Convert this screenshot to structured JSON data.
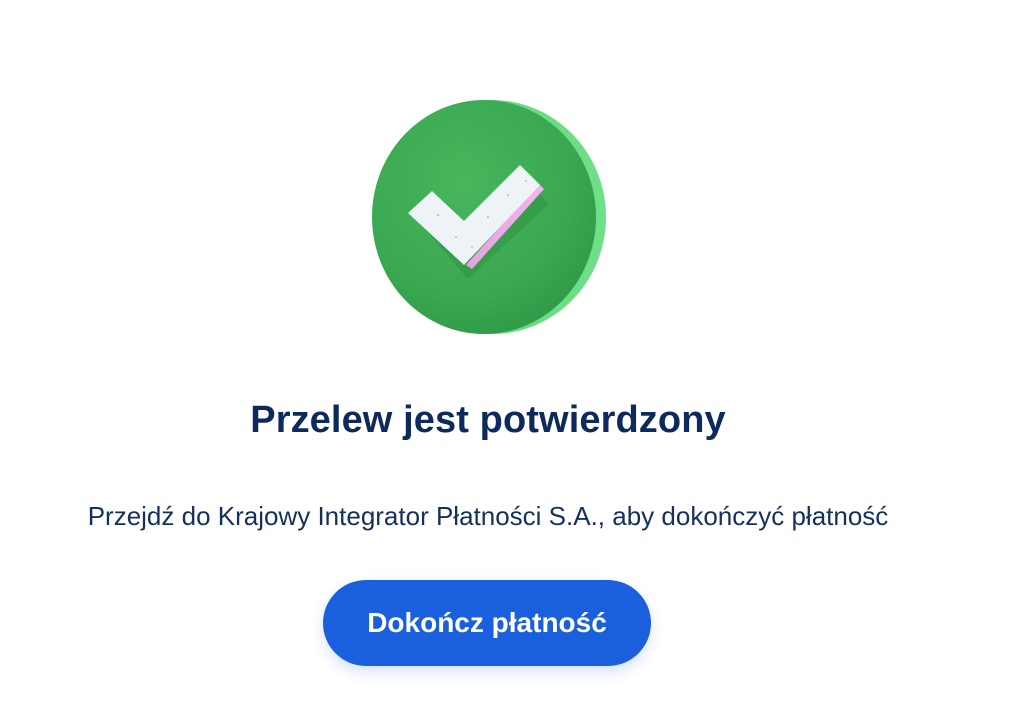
{
  "confirmation": {
    "icon": "checkmark-success-icon",
    "title": "Przelew jest potwierdzony",
    "message": "Przejdź do Krajowy Integrator Płatności S.A., aby dokończyć płatność",
    "button_label": "Dokończ płatność"
  },
  "colors": {
    "title": "#0e2a5c",
    "text": "#15305f",
    "button": "#1a5fdb",
    "badge_green": "#3dab55"
  }
}
